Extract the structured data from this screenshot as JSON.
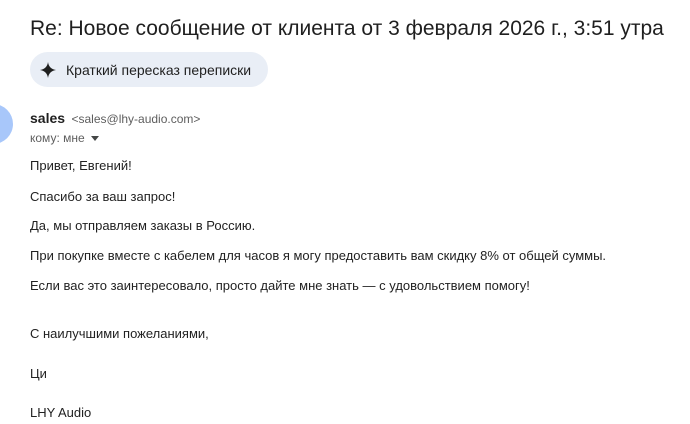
{
  "email": {
    "subject": "Re: Новое сообщение от клиента от 3 февраля 2026 г., 3:51 утра",
    "summary_button": "Краткий пересказ переписки",
    "sender": {
      "name": "sales",
      "email": "<sales@lhy-audio.com>"
    },
    "recipient": "кому: мне",
    "body": {
      "greeting": "Привет, Евгений!",
      "thanks": "Спасибо за ваш запрос!",
      "shipping": "Да, мы отправляем заказы в Россию.",
      "discount": "При покупке вместе с кабелем для часов я могу предоставить вам скидку 8% от общей суммы.",
      "closing": "Если вас это заинтересовало, просто дайте мне знать — с удовольствием помогу!",
      "regards": "С наилучшими пожеланиями,",
      "signature_name": "Ци",
      "signature_company": "LHY Audio"
    }
  },
  "icons": {
    "summary": "sparkle-icon",
    "recipient_dropdown": "chevron-down-icon"
  },
  "colors": {
    "summary_button_bg": "#e9eef6",
    "avatar": "#a8c7fa",
    "secondary_text": "#5e5e5e"
  }
}
